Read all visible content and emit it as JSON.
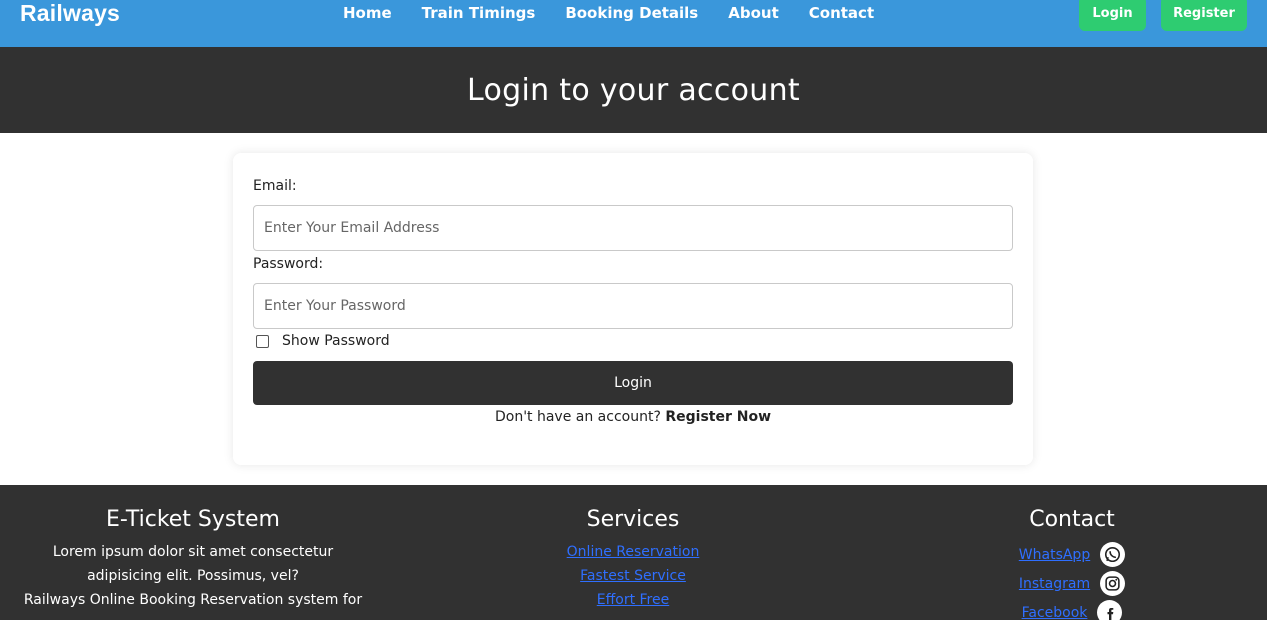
{
  "header": {
    "brand": "Railways",
    "nav": [
      "Home",
      "Train Timings",
      "Booking Details",
      "About",
      "Contact"
    ],
    "login_label": "Login",
    "register_label": "Register"
  },
  "page": {
    "title": "Login to your account"
  },
  "form": {
    "email_label": "Email:",
    "email_placeholder": "Enter Your Email Address",
    "password_label": "Password:",
    "password_placeholder": "Enter Your Password",
    "show_password_label": "Show Password",
    "submit_label": "Login",
    "register_prompt": "Don't have an account? ",
    "register_link": "Register Now"
  },
  "footer": {
    "about": {
      "title": "E-Ticket System",
      "lines": [
        "Lorem ipsum dolor sit amet consectetur",
        "adipisicing elit. Possimus, vel?",
        "Railways Online Booking Reservation system for"
      ]
    },
    "services": {
      "title": "Services",
      "links": [
        "Online Reservation",
        "Fastest Service",
        "Effort Free"
      ]
    },
    "contact": {
      "title": "Contact",
      "links": [
        {
          "label": "WhatsApp",
          "icon": "whatsapp-icon"
        },
        {
          "label": "Instagram",
          "icon": "instagram-icon"
        },
        {
          "label": "Facebook",
          "icon": "facebook-icon"
        }
      ]
    }
  },
  "colors": {
    "navbar": "#3a97db",
    "accent_green": "#2ecc71",
    "dark": "#313131",
    "link_blue": "#2f6fff"
  }
}
